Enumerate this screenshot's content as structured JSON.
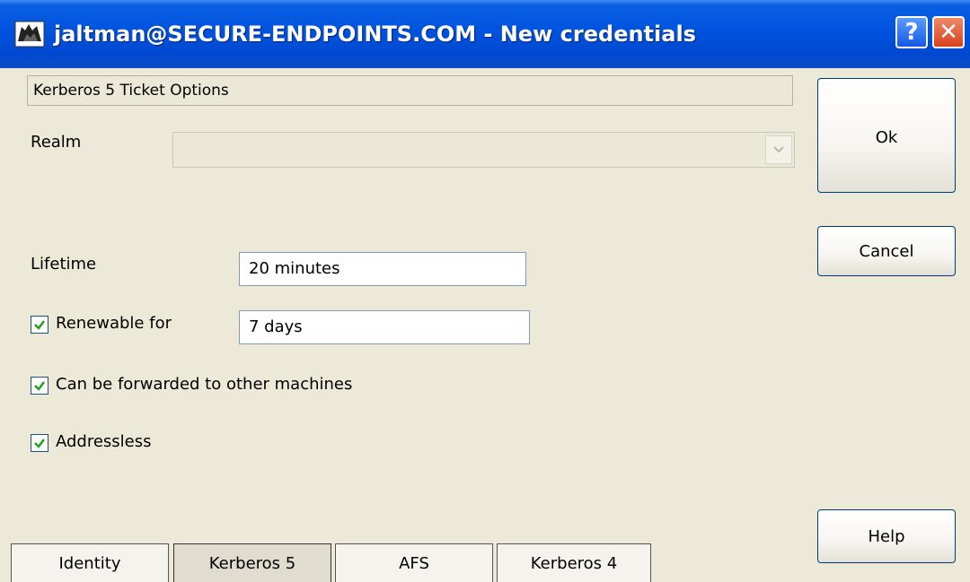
{
  "window": {
    "title": "jaltman@SECURE-ENDPOINTS.COM - New credentials",
    "help_glyph": "?",
    "close_glyph": "✕",
    "colors": {
      "titlebar": "#0053df",
      "background": "#ece9d8",
      "close": "#d6411c"
    }
  },
  "section": {
    "header": "Kerberos 5 Ticket Options"
  },
  "form": {
    "realm_label": "Realm",
    "realm_value": "",
    "lifetime_label": "Lifetime",
    "lifetime_value": "20 minutes",
    "renewable_label": "Renewable for",
    "renewable_checked": true,
    "renewable_value": "7 days",
    "forwardable_label": "Can be forwarded to other machines",
    "forwardable_checked": true,
    "addressless_label": "Addressless",
    "addressless_checked": true
  },
  "buttons": {
    "ok": "Ok",
    "cancel": "Cancel",
    "help": "Help"
  },
  "tabs": [
    {
      "label": "Identity",
      "active": false
    },
    {
      "label": "Kerberos 5",
      "active": true
    },
    {
      "label": "AFS",
      "active": false
    },
    {
      "label": "Kerberos 4",
      "active": false
    }
  ],
  "icons": {
    "app": "kerberos-dog-icon",
    "check": "checkmark-icon",
    "dropdown": "chevron-down-icon"
  }
}
